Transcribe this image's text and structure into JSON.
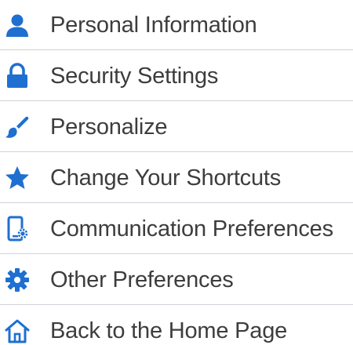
{
  "accent_color": "#1f6fd1",
  "menu": {
    "items": [
      {
        "label": "Personal Information",
        "icon": "person-icon"
      },
      {
        "label": "Security Settings",
        "icon": "lock-icon"
      },
      {
        "label": "Personalize",
        "icon": "paintbrush-icon"
      },
      {
        "label": "Change Your Shortcuts",
        "icon": "star-icon"
      },
      {
        "label": "Communication Preferences",
        "icon": "mobile-gear-icon"
      },
      {
        "label": "Other Preferences",
        "icon": "gear-icon"
      },
      {
        "label": "Back to the Home Page",
        "icon": "home-icon"
      }
    ]
  }
}
